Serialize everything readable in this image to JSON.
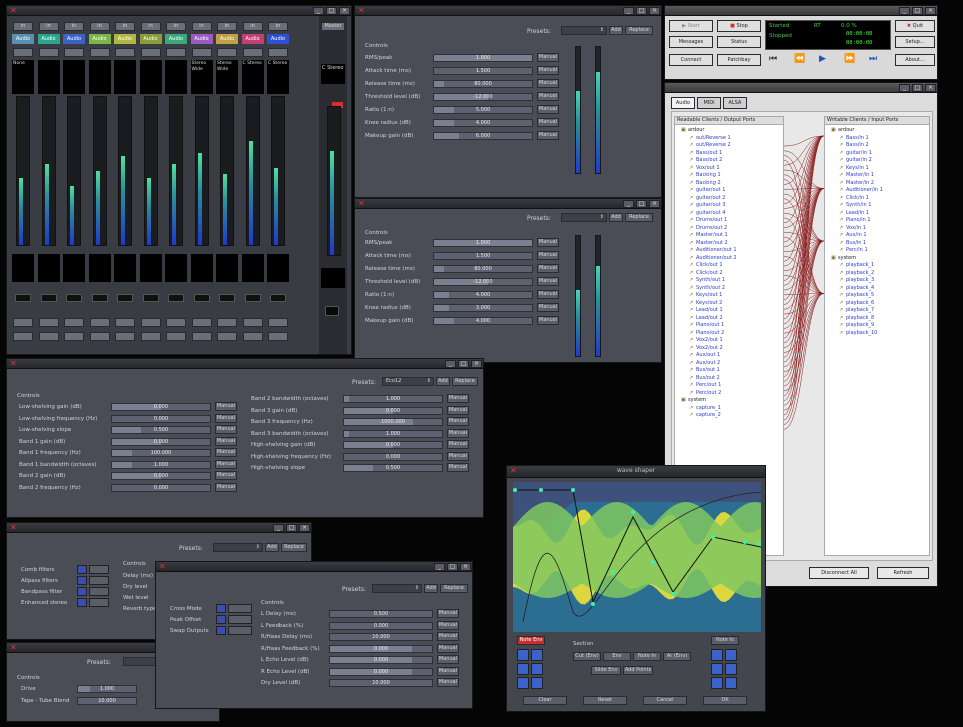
{
  "mixer": {
    "channels": [
      {
        "name": "Audio",
        "color": "#5a8fb0",
        "label": "None"
      },
      {
        "name": "Audio",
        "color": "#2fa48c",
        "label": ""
      },
      {
        "name": "Audio",
        "color": "#3a62c8",
        "label": ""
      },
      {
        "name": "Audio",
        "color": "#7ab64a",
        "label": ""
      },
      {
        "name": "Audio",
        "color": "#b0b640",
        "label": ""
      },
      {
        "name": "Audio",
        "color": "#8c9c3a",
        "label": ""
      },
      {
        "name": "Audio",
        "color": "#3aa87a",
        "label": ""
      },
      {
        "name": "Audio",
        "color": "#9a5cc0",
        "label": "Stereo Wide"
      },
      {
        "name": "Audio",
        "color": "#c0a040",
        "label": "Stereo Wide"
      },
      {
        "name": "Audio",
        "color": "#c04070",
        "label": "C Stereo"
      },
      {
        "name": "Audio",
        "color": "#3050d0",
        "label": "C Stereo"
      }
    ],
    "master": {
      "name": "Master",
      "label": "C Stereo"
    }
  },
  "comp1": {
    "presets_label": "Presets:",
    "add": "Add",
    "replace": "Replace",
    "controls": "Controls",
    "manual": "Manual",
    "params": [
      {
        "label": "RMS/peak",
        "value": "1.000",
        "fill": 100
      },
      {
        "label": "Attack time (ms)",
        "value": "1.500",
        "fill": 0
      },
      {
        "label": "Release time (ms)",
        "value": "80.000",
        "fill": 10
      },
      {
        "label": "Threshold level (dB)",
        "value": "-12.000",
        "fill": 55
      },
      {
        "label": "Ratio (1:n)",
        "value": "5.000",
        "fill": 20
      },
      {
        "label": "Knee radius (dB)",
        "value": "4.000",
        "fill": 20
      },
      {
        "label": "Makeup gain (dB)",
        "value": "6.000",
        "fill": 25
      }
    ]
  },
  "comp2": {
    "presets_label": "Presets:",
    "add": "Add",
    "replace": "Replace",
    "controls": "Controls",
    "manual": "Manual",
    "params": [
      {
        "label": "RMS/peak",
        "value": "1.000",
        "fill": 100
      },
      {
        "label": "Attack time (ms)",
        "value": "1.500",
        "fill": 0
      },
      {
        "label": "Release time (ms)",
        "value": "80.000",
        "fill": 10
      },
      {
        "label": "Threshold level (dB)",
        "value": "-12.000",
        "fill": 55
      },
      {
        "label": "Ratio (1:n)",
        "value": "4.000",
        "fill": 15
      },
      {
        "label": "Knee radius (dB)",
        "value": "3.000",
        "fill": 15
      },
      {
        "label": "Makeup gain (dB)",
        "value": "4.000",
        "fill": 20
      }
    ]
  },
  "eq": {
    "presets_label": "Presets:",
    "preset": "Eco12",
    "add": "Add",
    "replace": "Replace",
    "controls": "Controls",
    "manual": "Manual",
    "left": [
      {
        "label": "Low-shelving gain (dB)",
        "value": "0.000",
        "fill": 50
      },
      {
        "label": "Low-shelving frequency (Hz)",
        "value": "0.000",
        "fill": 0
      },
      {
        "label": "Low-shelving slope",
        "value": "0.500",
        "fill": 30
      },
      {
        "label": "Band 1 gain (dB)",
        "value": "0.000",
        "fill": 50
      },
      {
        "label": "Band 1 frequency (Hz)",
        "value": "100.000",
        "fill": 20
      },
      {
        "label": "Band 1 bandwidth (octaves)",
        "value": "1.000",
        "fill": 20
      },
      {
        "label": "Band 2 gain (dB)",
        "value": "0.000",
        "fill": 50
      },
      {
        "label": "Band 2 frequency (Hz)",
        "value": "0.000",
        "fill": 0
      }
    ],
    "right": [
      {
        "label": "Band 2 bandwidth (octaves)",
        "value": "1.000",
        "fill": 5
      },
      {
        "label": "Band 3 gain (dB)",
        "value": "0.000",
        "fill": 50
      },
      {
        "label": "Band 3 frequency (Hz)",
        "value": "1000.000",
        "fill": 70
      },
      {
        "label": "Band 3 bandwidth (octaves)",
        "value": "1.000",
        "fill": 5
      },
      {
        "label": "High-shelving gain (dB)",
        "value": "0.000",
        "fill": 50
      },
      {
        "label": "High-shelving frequency (Hz)",
        "value": "0.000",
        "fill": 0
      },
      {
        "label": "High-shelving slope",
        "value": "0.500",
        "fill": 30
      }
    ]
  },
  "chorus": {
    "presets_label": "Presets:",
    "add": "Add",
    "replace": "Replace",
    "controls": "Controls",
    "items": [
      "Comb filters",
      "Allpass filters",
      "Bandpass filter",
      "Enhanced stereo"
    ],
    "right": [
      "Delay (ms)",
      "Dry level",
      "Wet level",
      "Reverb type"
    ]
  },
  "delay": {
    "presets_label": "Presets:",
    "add": "Add",
    "replace": "Replace",
    "controls": "Controls",
    "manual": "Manual",
    "toggles": [
      "Cross Mode",
      "Peak Offset",
      "Swap Outputs"
    ],
    "params": [
      {
        "label": "L Delay (ms)",
        "value": "0.500",
        "fill": 0
      },
      {
        "label": "L Feedback (%)",
        "value": "0.000",
        "fill": 0
      },
      {
        "label": "R/Haas Delay (ms)",
        "value": "10.000",
        "fill": 0
      },
      {
        "label": "R/Haas Feedback (%)",
        "value": "0.000",
        "fill": 80
      },
      {
        "label": "L Echo Level (dB)",
        "value": "0.000",
        "fill": 80
      },
      {
        "label": "R Echo Level (dB)",
        "value": "0.000",
        "fill": 80
      },
      {
        "label": "Dry Level (dB)",
        "value": "10.000",
        "fill": 0
      }
    ]
  },
  "small": {
    "presets_label": "Presets:",
    "controls": "Controls",
    "params": [
      {
        "label": "Drive",
        "value": "1.000",
        "fill": 20
      },
      {
        "label": "Tape - Tube Blend",
        "value": "10.000",
        "fill": 0
      }
    ]
  },
  "transport": {
    "stop": "Stop",
    "quit": "Quit",
    "messages": "Messages",
    "status": "Status",
    "setup": "Setup...",
    "connect": "Connect",
    "patchbay": "Patchbay",
    "about": "About...",
    "lcd": {
      "started": "Started",
      "rt": "RT",
      "dsp": "0.0 %",
      "time1": "00:00:00",
      "time2": "00:00:00",
      "stopped": "Stopped"
    }
  },
  "connections": {
    "tabs": [
      "Audio",
      "MIDI",
      "ALSA"
    ],
    "left_header": "Readable Clients / Output Ports",
    "right_header": "Writable Clients / Input Ports",
    "left_items": [
      {
        "t": "ardour",
        "g": true
      },
      {
        "t": "out/Reverse 1"
      },
      {
        "t": "out/Reverse 2"
      },
      {
        "t": "Bass/out 1"
      },
      {
        "t": "Bass/out 2"
      },
      {
        "t": "Vox/out 1"
      },
      {
        "t": "Backing 1"
      },
      {
        "t": "Backing 2"
      },
      {
        "t": "guitar/out 1"
      },
      {
        "t": "guitar/out 2"
      },
      {
        "t": "guitar/out 3"
      },
      {
        "t": "guitar/out 4"
      },
      {
        "t": "Drums/out 1"
      },
      {
        "t": "Drums/out 2"
      },
      {
        "t": "Master/out 1"
      },
      {
        "t": "Master/out 2"
      },
      {
        "t": "Auditioner/out 1"
      },
      {
        "t": "Auditioner/out 2"
      },
      {
        "t": "Click/out 1"
      },
      {
        "t": "Click/out 2"
      },
      {
        "t": "Synth/out 1"
      },
      {
        "t": "Synth/out 2"
      },
      {
        "t": "Keys/out 1"
      },
      {
        "t": "Keys/out 2"
      },
      {
        "t": "Lead/out 1"
      },
      {
        "t": "Lead/out 2"
      },
      {
        "t": "Piano/out 1"
      },
      {
        "t": "Piano/out 2"
      },
      {
        "t": "Vox2/out 1"
      },
      {
        "t": "Vox2/out 2"
      },
      {
        "t": "Aux/out 1"
      },
      {
        "t": "Aux/out 2"
      },
      {
        "t": "Bus/out 1"
      },
      {
        "t": "Bus/out 2"
      },
      {
        "t": "Perc/out 1"
      },
      {
        "t": "Perc/out 2"
      },
      {
        "t": "system",
        "g": true
      },
      {
        "t": "capture_1"
      },
      {
        "t": "capture_2"
      }
    ],
    "right_items": [
      {
        "t": "ardour",
        "g": true
      },
      {
        "t": "Bass/in 1"
      },
      {
        "t": "Bass/in 2"
      },
      {
        "t": "guitar/in 1"
      },
      {
        "t": "guitar/in 2"
      },
      {
        "t": "Keys/in 1"
      },
      {
        "t": "Master/in 1"
      },
      {
        "t": "Master/in 2"
      },
      {
        "t": "Auditioner/in 1"
      },
      {
        "t": "Click/in 1"
      },
      {
        "t": "Synth/in 1"
      },
      {
        "t": "Lead/in 1"
      },
      {
        "t": "Piano/in 1"
      },
      {
        "t": "Vox/in 1"
      },
      {
        "t": "Aux/in 1"
      },
      {
        "t": "Bus/in 1"
      },
      {
        "t": "Perc/in 1"
      },
      {
        "t": "system",
        "g": true
      },
      {
        "t": "playback_1"
      },
      {
        "t": "playback_2"
      },
      {
        "t": "playback_3"
      },
      {
        "t": "playback_4"
      },
      {
        "t": "playback_5"
      },
      {
        "t": "playback_6"
      },
      {
        "t": "playback_7"
      },
      {
        "t": "playback_8"
      },
      {
        "t": "playback_9"
      },
      {
        "t": "playback_10"
      }
    ],
    "disconnect_all": "Disconnect All",
    "refresh": "Refresh"
  },
  "wave": {
    "title": "wave shaper",
    "section": "Section",
    "buttons": [
      "Cut (Env)",
      "Env",
      "Note In",
      "Ar (Env)"
    ],
    "row2": [
      "Slide Env",
      "Add Points"
    ],
    "bottom": [
      "Clear",
      "Reset",
      "Cancel",
      "OK"
    ],
    "left_btn": "Note Env",
    "right_btn": "Note In"
  }
}
